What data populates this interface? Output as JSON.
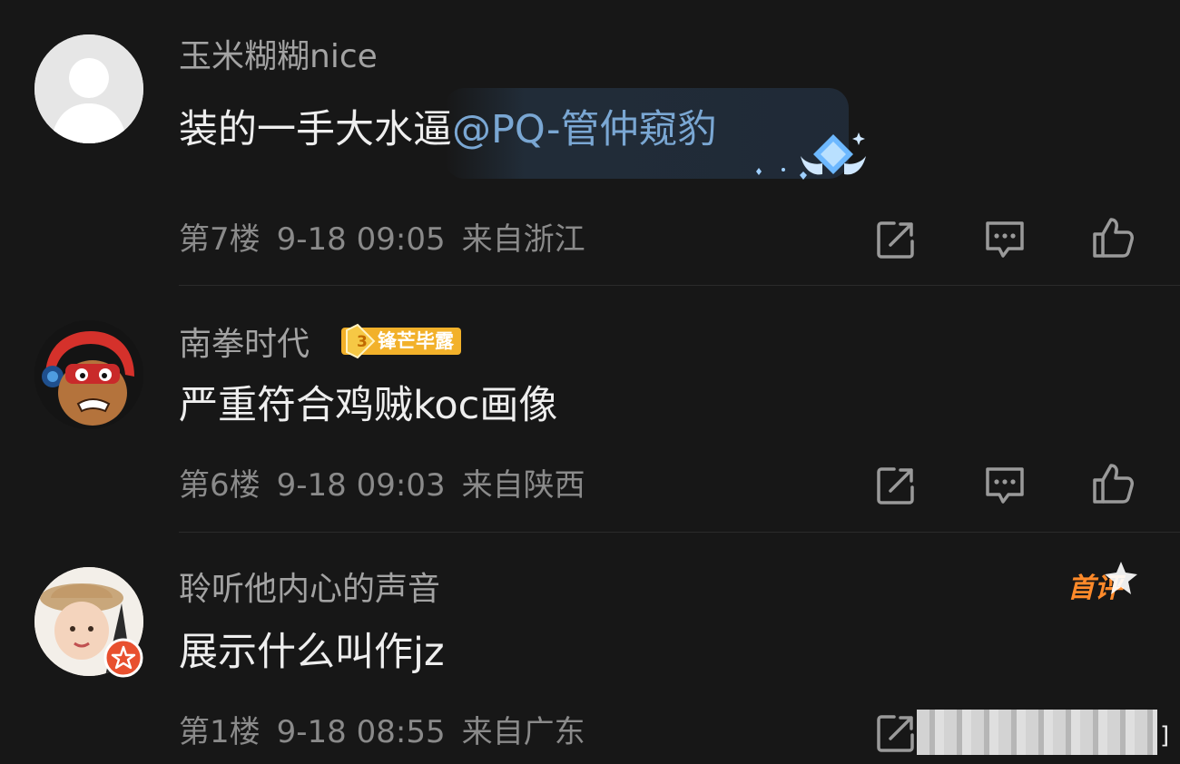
{
  "comments": [
    {
      "username": "玉米糊糊nice",
      "content_text": "装的一手大水逼",
      "mention": "@PQ-管仲窥豹",
      "floor": "第7楼",
      "time": "9-18 09:05",
      "location": "来自浙江"
    },
    {
      "username": "南拳时代",
      "badge_level": "3",
      "badge_label": "锋芒毕露",
      "content_text": "严重符合鸡贼koc画像",
      "floor": "第6楼",
      "time": "9-18 09:03",
      "location": "来自陕西"
    },
    {
      "username": "聆听他内心的声音",
      "first_tag": "首评",
      "content_text": "展示什么叫作jz",
      "floor": "第1楼",
      "time": "9-18 08:55",
      "location": "来自广东"
    }
  ],
  "icons": {
    "share": "share-icon",
    "reply": "reply-icon",
    "like": "like-icon"
  },
  "colors": {
    "background": "#171717",
    "username": "#a3a3a3",
    "content": "#eeeeee",
    "mention": "#7aa7d3",
    "badge": "#f2b12a",
    "first_tag": "#ff8a2a"
  }
}
